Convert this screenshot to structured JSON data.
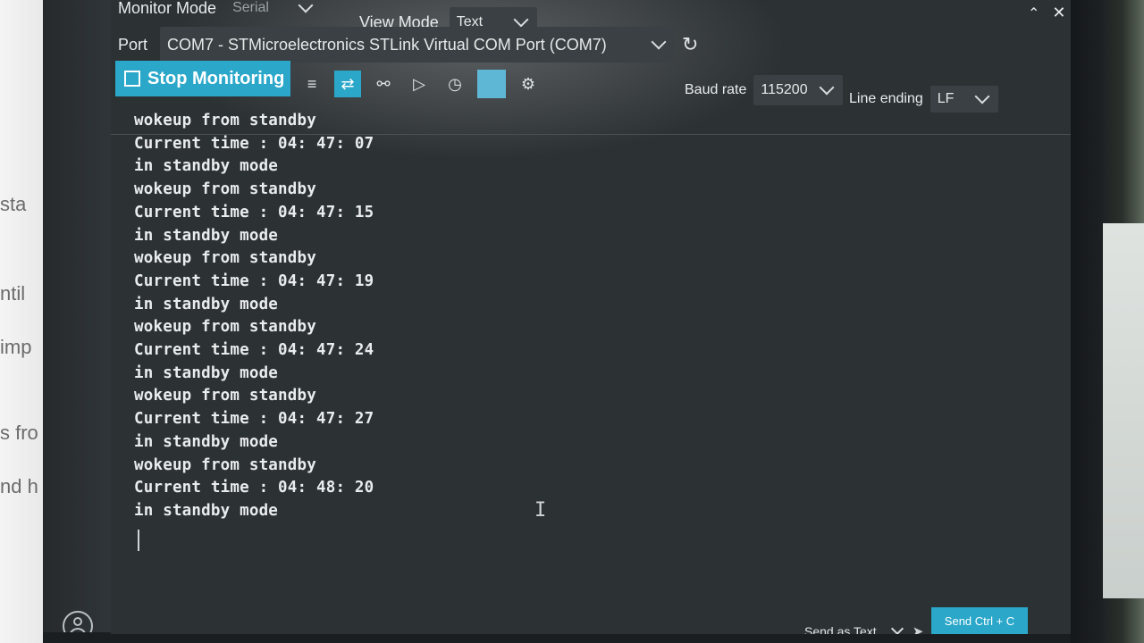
{
  "background_page": {
    "fragments": [
      "sta",
      "ntil",
      "imp",
      "s fro",
      "nd h"
    ]
  },
  "header": {
    "monitor_mode_label": "Monitor Mode",
    "monitor_mode_value": "Serial",
    "view_mode_label": "View Mode",
    "view_mode_value": "Text",
    "port_label": "Port",
    "port_value": "COM7 - STMicroelectronics STLink Virtual COM Port (COM7)",
    "baud_label": "Baud rate",
    "baud_value": "115200",
    "line_ending_label": "Line ending",
    "line_ending_value": "LF"
  },
  "toolbar": {
    "stop_label": "Stop Monitoring",
    "icons": [
      "clear-output-icon",
      "toggle-scroll-icon",
      "link-icon",
      "terminal-icon",
      "timestamp-icon",
      "color-icon",
      "settings-icon"
    ]
  },
  "output": {
    "lines": [
      "wokeup from standby",
      "Current time : 04: 47: 07",
      "in standby mode",
      "wokeup from standby",
      "Current time : 04: 47: 15",
      "in standby mode",
      "wokeup from standby",
      "Current time : 04: 47: 19",
      "in standby mode",
      "wokeup from standby",
      "Current time : 04: 47: 24",
      "in standby mode",
      "wokeup from standby",
      "Current time : 04: 47: 27",
      "in standby mode",
      "wokeup from standby",
      "Current time : 04: 48: 20",
      "in standby mode"
    ]
  },
  "footer": {
    "send_as_label": "Send as Text",
    "send_ctrl_label": "Send Ctrl + C"
  },
  "colors": {
    "accent": "#2aa7c9",
    "panel": "#2c3134",
    "text": "#e9ecec"
  }
}
